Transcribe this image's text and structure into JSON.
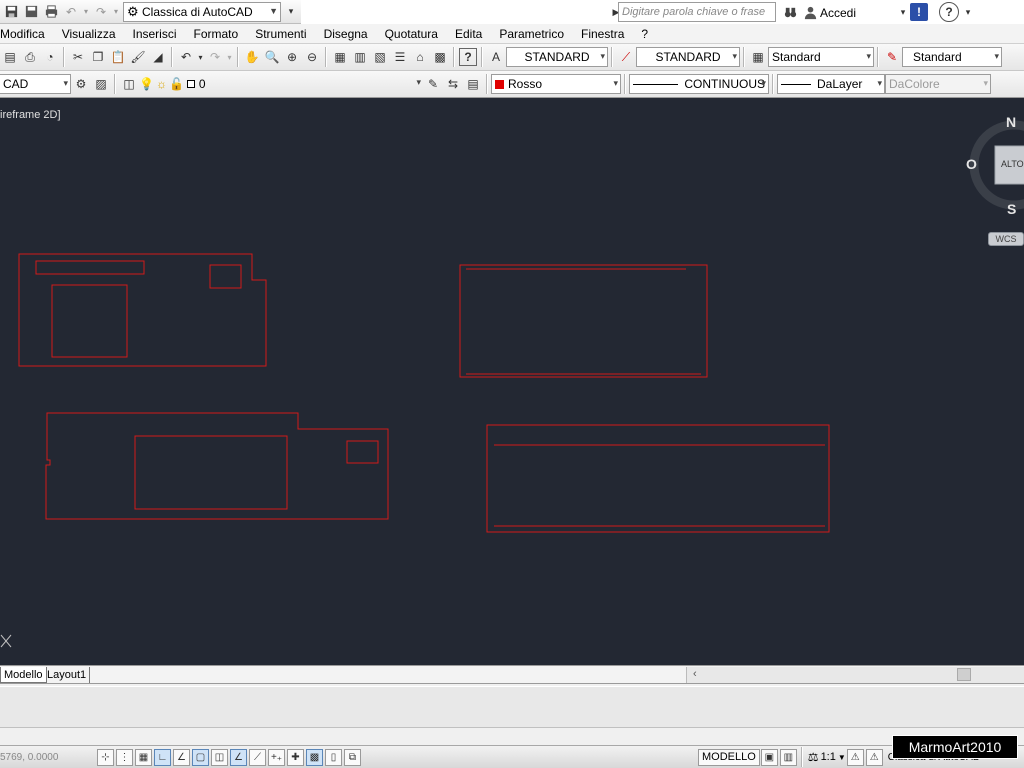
{
  "title_bar": {
    "workspace": "Classica di AutoCAD",
    "search_placeholder": "Digitare parola chiave o frase",
    "sign_in": "Accedi",
    "help": "?"
  },
  "menu": [
    "Modifica",
    "Visualizza",
    "Inserisci",
    "Formato",
    "Strumenti",
    "Disegna",
    "Quotatura",
    "Edita",
    "Parametrico",
    "Finestra",
    "?"
  ],
  "styles_toolbar": {
    "text_style": "STANDARD",
    "dim_style": "STANDARD",
    "table_style": "Standard",
    "mleader_style": "Standard"
  },
  "layers_toolbar": {
    "workspace_short": "CAD",
    "layer": "0",
    "color": "Rosso",
    "color_hex": "#e00000",
    "linetype": "CONTINUOUS",
    "lineweight": "DaLayer",
    "plot_style": "DaColore"
  },
  "viewport": {
    "label": "ireframe 2D]",
    "background": "#232833",
    "stroke": "#d11a1a"
  },
  "viewcube": {
    "north": "N",
    "south": "S",
    "west": "O",
    "face": "ALTO",
    "ucs": "WCS"
  },
  "layout_tabs": [
    "Modello",
    "Layout1"
  ],
  "status": {
    "coords": "5769, 0.0000",
    "space": "MODELLO",
    "scale": "1:1",
    "workspace": "Classica di AutoCAD"
  },
  "watermark": "MarmoArt2010"
}
